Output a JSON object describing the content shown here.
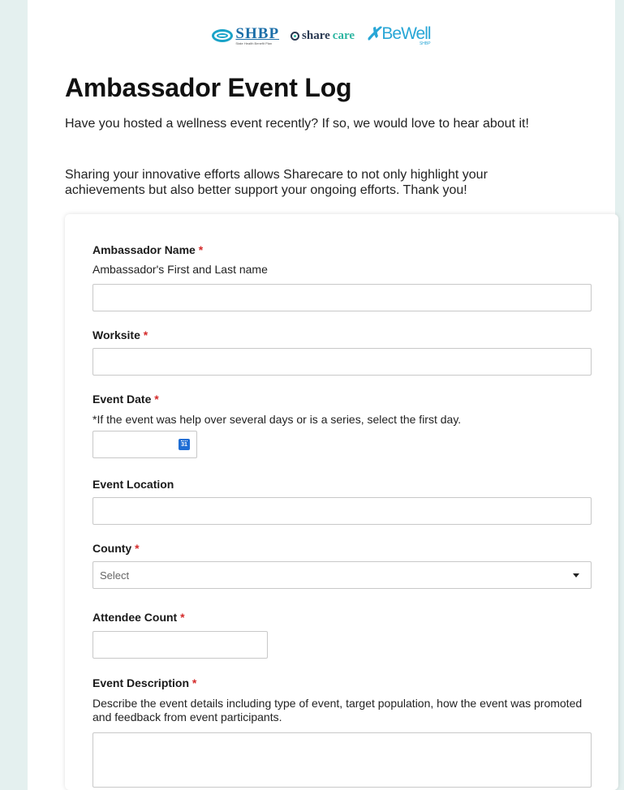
{
  "logos": {
    "shbp_text": "SHBP",
    "shbp_tagline": "State Health Benefit Plan",
    "sharecare_part1": "share",
    "sharecare_part2": "care",
    "bewell_text": "BeWell",
    "bewell_sub": "SHBP"
  },
  "page": {
    "title": "Ambassador Event Log",
    "intro_1": "Have you hosted a wellness event recently? If so, we would love to hear about it!",
    "intro_2": "Sharing your innovative efforts allows Sharecare to not only highlight your achievements but also better support your ongoing efforts. Thank you!"
  },
  "form": {
    "required_mark": "*",
    "ambassador_name": {
      "label": "Ambassador Name",
      "help": "Ambassador's First and Last name",
      "value": ""
    },
    "worksite": {
      "label": "Worksite",
      "value": ""
    },
    "event_date": {
      "label": "Event Date",
      "help": "*If the event was help over several days or is a series, select the first day.",
      "value": "",
      "calendar_icon_text": "31"
    },
    "event_location": {
      "label": "Event Location",
      "value": ""
    },
    "county": {
      "label": "County",
      "selected": "Select"
    },
    "attendee_count": {
      "label": "Attendee Count",
      "value": ""
    },
    "event_description": {
      "label": "Event Description",
      "help": "Describe the event details including type of event, target population, how the event was promoted and feedback from event participants.",
      "value": ""
    }
  },
  "colors": {
    "background": "#e4f0ef",
    "required": "#d42a2a",
    "calendar_icon": "#1f6ed4",
    "shbp_blue": "#1b6ea8",
    "sharecare_teal": "#2fb6a2"
  }
}
